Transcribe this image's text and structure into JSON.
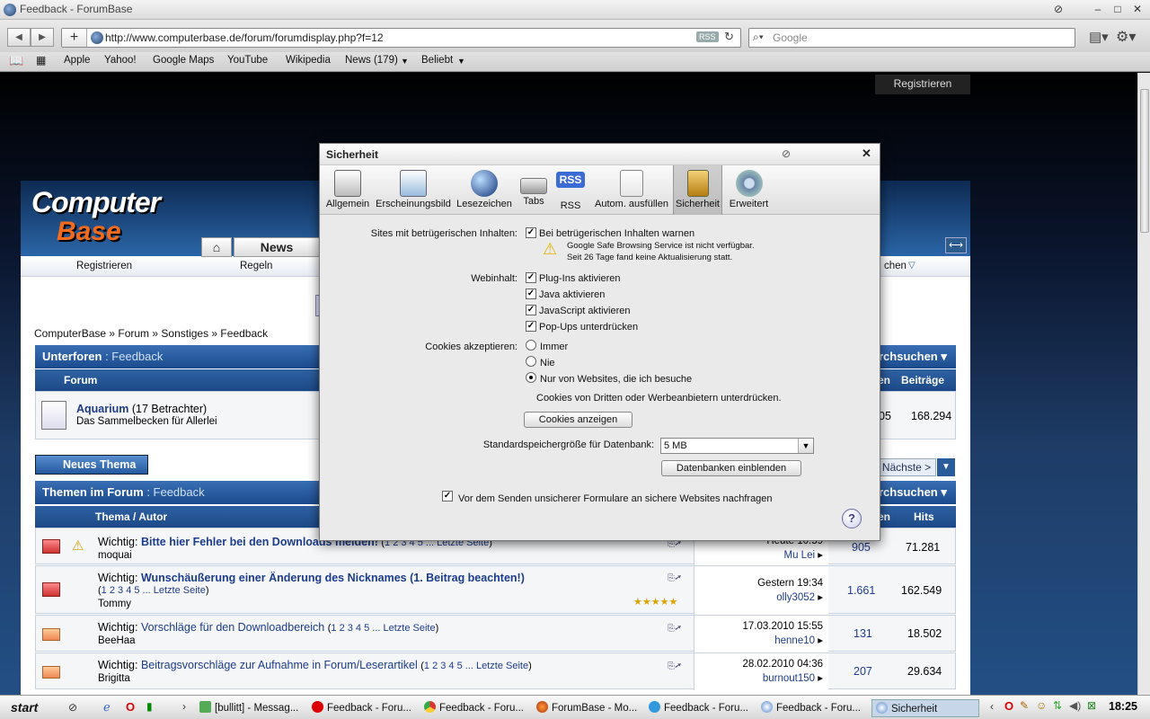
{
  "browser": {
    "window_title": "Feedback - ForumBase",
    "url": "http://www.computerbase.de/forum/forumdisplay.php?f=12",
    "rss_label": "RSS",
    "search_placeholder": "Google",
    "bookmarks": [
      "Apple",
      "Yahoo!",
      "Google Maps",
      "YouTube",
      "Wikipedia",
      "News (179)",
      "Beliebt"
    ]
  },
  "site": {
    "logo_top": "Computer",
    "logo_bottom": "Base",
    "nav_tab": "News",
    "registrieren_top": "Registrieren",
    "subnav": [
      "Registrieren",
      "Regeln",
      "chen"
    ],
    "breadcrumb": "ComputerBase » Forum » Sonstiges » Feedback",
    "unterforen_title": "Unterforen",
    "unterforen_sub": ": Feedback",
    "durchsuchen": "rchsuchen",
    "forum_col": "Forum",
    "col_en": "en",
    "col_beitraege": "Beiträge",
    "aquarium_name": "Aquarium",
    "aquarium_viewers": "(17 Betrachter)",
    "aquarium_desc": "Das Sammelbecken für Allerlei",
    "aquarium_threads": "05",
    "aquarium_posts": "168.294",
    "neues_thema": "Neues Thema",
    "naechste": "Nächste >",
    "themen_title": "Themen im Forum",
    "themen_sub": ": Feedback",
    "col_thema": "Thema / Autor",
    "col_hits": "Hits",
    "threads": [
      {
        "prefix": "Wichtig:",
        "title": "Bitte hier Fehler bei den Downloads melden!",
        "pages": "1 2 3 4 5 ... Letzte Seite",
        "author": "moquai",
        "date": "Heute 10:59",
        "by": "Mu Lei",
        "replies": "905",
        "hits": "71.281"
      },
      {
        "prefix": "Wichtig:",
        "title": "Wunschäußerung einer Änderung des Nicknames (1. Beitrag beachten!)",
        "pages": "1 2 3 4 5 ... Letzte Seite",
        "author": "Tommy",
        "date": "Gestern 19:34",
        "by": "olly3052",
        "replies": "1.661",
        "hits": "162.549"
      },
      {
        "prefix": "Wichtig:",
        "title": "Vorschläge für den Downloadbereich",
        "pages": "1 2 3 4 5 ... Letzte Seite",
        "author": "BeeHaa",
        "date": "17.03.2010 15:55",
        "by": "henne10",
        "replies": "131",
        "hits": "18.502"
      },
      {
        "prefix": "Wichtig:",
        "title": "Beitragsvorschläge zur Aufnahme in Forum/Leserartikel",
        "pages": "1 2 3 4 5 ... Letzte Seite",
        "author": "Brigitta",
        "date": "28.02.2010 04:36",
        "by": "burnout150",
        "replies": "207",
        "hits": "29.634"
      }
    ]
  },
  "dialog": {
    "title": "Sicherheit",
    "tabs": [
      "Allgemein",
      "Erscheinungsbild",
      "Lesezeichen",
      "Tabs",
      "RSS",
      "Autom. ausfüllen",
      "Sicherheit",
      "Erweitert"
    ],
    "fraud_label": "Sites mit betrügerischen Inhalten:",
    "fraud_check": "Bei betrügerischen Inhalten warnen",
    "fraud_warn1": "Google Safe Browsing Service ist nicht verfügbar.",
    "fraud_warn2": "Seit 26 Tage fand keine Aktualisierung statt.",
    "web_label": "Webinhalt:",
    "web_items": [
      "Plug-Ins aktivieren",
      "Java aktivieren",
      "JavaScript aktivieren",
      "Pop-Ups unterdrücken"
    ],
    "cookies_label": "Cookies akzeptieren:",
    "cookie_options": [
      "Immer",
      "Nie",
      "Nur von Websites, die ich besuche"
    ],
    "cookie_note": "Cookies von Dritten oder Werbeanbietern unterdrücken.",
    "cookie_button": "Cookies anzeigen",
    "db_label": "Standardspeichergröße für Datenbank:",
    "db_value": "5 MB",
    "db_button": "Datenbanken einblenden",
    "form_check": "Vor dem Senden unsicherer Formulare an sichere Websites nachfragen",
    "help": "?"
  },
  "taskbar": {
    "start": "start",
    "items": [
      "[bullitt] - Messag...",
      "Feedback - Foru...",
      "Feedback - Foru...",
      "ForumBase - Mo...",
      "Feedback - Foru...",
      "Feedback - Foru...",
      "Sicherheit"
    ],
    "clock": "18:25"
  }
}
